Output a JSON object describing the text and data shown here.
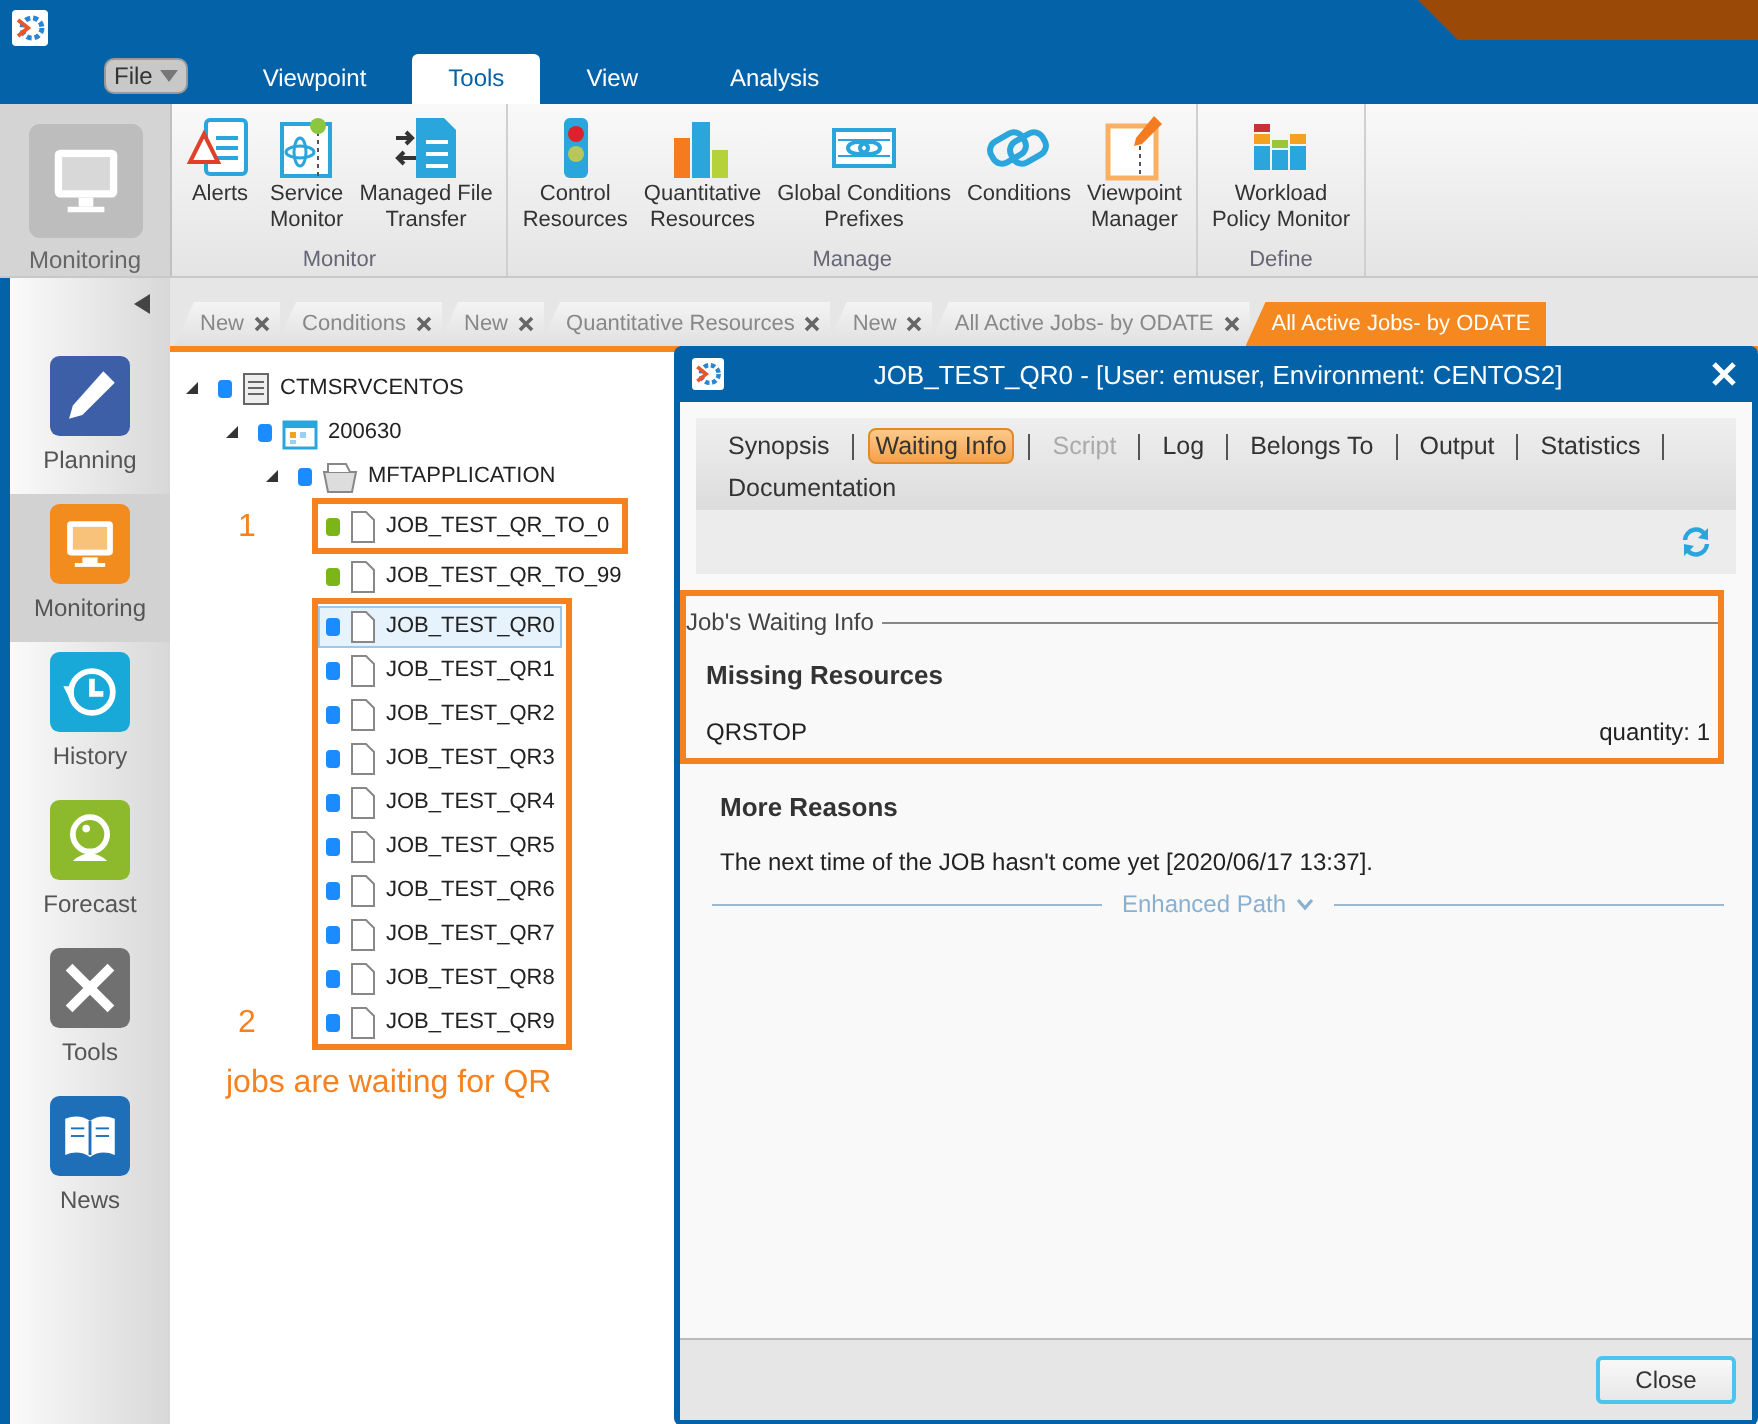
{
  "file_menu": {
    "label": "File"
  },
  "ribbon_tabs": [
    {
      "label": "Viewpoint",
      "selected": false
    },
    {
      "label": "Tools",
      "selected": true
    },
    {
      "label": "View",
      "selected": false
    },
    {
      "label": "Analysis",
      "selected": false
    }
  ],
  "ribbon": {
    "home": {
      "label": "Monitoring"
    },
    "groups": [
      {
        "name": "Monitor",
        "buttons": [
          {
            "lines": [
              "Alerts"
            ]
          },
          {
            "lines": [
              "Service",
              "Monitor"
            ]
          },
          {
            "lines": [
              "Managed File",
              "Transfer"
            ]
          }
        ]
      },
      {
        "name": "Manage",
        "buttons": [
          {
            "lines": [
              "Control",
              "Resources"
            ]
          },
          {
            "lines": [
              "Quantitative",
              "Resources"
            ]
          },
          {
            "lines": [
              "Global Conditions",
              "Prefixes"
            ]
          },
          {
            "lines": [
              "Conditions"
            ]
          },
          {
            "lines": [
              "Viewpoint",
              "Manager"
            ]
          }
        ]
      },
      {
        "name": "Define",
        "buttons": [
          {
            "lines": [
              "Workload",
              "Policy Monitor"
            ]
          }
        ]
      }
    ]
  },
  "sidebar": {
    "items": [
      {
        "label": "Planning",
        "selected": false
      },
      {
        "label": "Monitoring",
        "selected": true
      },
      {
        "label": "History",
        "selected": false
      },
      {
        "label": "Forecast",
        "selected": false
      },
      {
        "label": "Tools",
        "selected": false
      },
      {
        "label": "News",
        "selected": false
      }
    ]
  },
  "doc_tabs": [
    {
      "label": "New",
      "selected": false
    },
    {
      "label": "Conditions",
      "selected": false
    },
    {
      "label": "New",
      "selected": false
    },
    {
      "label": "Quantitative Resources",
      "selected": false
    },
    {
      "label": "New",
      "selected": false
    },
    {
      "label": "All Active Jobs- by ODATE",
      "selected": false
    },
    {
      "label": "All Active Jobs- by ODATE",
      "selected": true
    }
  ],
  "tree": {
    "nodes": [
      {
        "label": "CTMSRVCENTOS",
        "color": "#1a8cff",
        "expanded": true,
        "selected": false,
        "children": [
          {
            "label": "200630",
            "color": "#1a8cff",
            "expanded": true,
            "selected": false,
            "children": [
              {
                "label": "MFTAPPLICATION",
                "color": "#1a8cff",
                "expanded": true,
                "selected": false,
                "children": [
                  {
                    "label": "JOB_TEST_QR_TO_0",
                    "color": "#7cb518",
                    "selected": false,
                    "boxed": true
                  },
                  {
                    "label": "JOB_TEST_QR_TO_99",
                    "color": "#7cb518",
                    "selected": false,
                    "boxed": false
                  },
                  {
                    "label": "JOB_TEST_QR0",
                    "color": "#1a8cff",
                    "selected": true,
                    "boxed": true
                  },
                  {
                    "label": "JOB_TEST_QR1",
                    "color": "#1a8cff",
                    "selected": false,
                    "boxed": true
                  },
                  {
                    "label": "JOB_TEST_QR2",
                    "color": "#1a8cff",
                    "selected": false,
                    "boxed": true
                  },
                  {
                    "label": "JOB_TEST_QR3",
                    "color": "#1a8cff",
                    "selected": false,
                    "boxed": true
                  },
                  {
                    "label": "JOB_TEST_QR4",
                    "color": "#1a8cff",
                    "selected": false,
                    "boxed": true
                  },
                  {
                    "label": "JOB_TEST_QR5",
                    "color": "#1a8cff",
                    "selected": false,
                    "boxed": true
                  },
                  {
                    "label": "JOB_TEST_QR6",
                    "color": "#1a8cff",
                    "selected": false,
                    "boxed": true
                  },
                  {
                    "label": "JOB_TEST_QR7",
                    "color": "#1a8cff",
                    "selected": false,
                    "boxed": true
                  },
                  {
                    "label": "JOB_TEST_QR8",
                    "color": "#1a8cff",
                    "selected": false,
                    "boxed": true
                  },
                  {
                    "label": "JOB_TEST_QR9",
                    "color": "#1a8cff",
                    "selected": false,
                    "boxed": true
                  }
                ]
              }
            ]
          }
        ]
      }
    ]
  },
  "annotations": {
    "box_labels": [
      "1",
      "2"
    ],
    "caption": "jobs are waiting for QR"
  },
  "dialog": {
    "title": "JOB_TEST_QR0 - [User: emuser, Environment: CENTOS2]",
    "tabs": [
      {
        "label": "Synopsis",
        "selected": false,
        "disabled": false
      },
      {
        "label": "Waiting Info",
        "selected": true,
        "disabled": false
      },
      {
        "label": "Script",
        "selected": false,
        "disabled": true
      },
      {
        "label": "Log",
        "selected": false,
        "disabled": false
      },
      {
        "label": "Belongs To",
        "selected": false,
        "disabled": false
      },
      {
        "label": "Output",
        "selected": false,
        "disabled": false
      },
      {
        "label": "Statistics",
        "selected": false,
        "disabled": false
      },
      {
        "label": "Documentation",
        "selected": false,
        "disabled": false
      }
    ],
    "waiting_info": {
      "legend": "Job's Waiting Info",
      "heading": "Missing Resources",
      "highlighted": true,
      "resources": [
        {
          "name": "QRSTOP",
          "quantity": "quantity: 1"
        }
      ]
    },
    "more_reasons": {
      "heading": "More Reasons",
      "text": "The next time of the JOB hasn't come yet [2020/06/17 13:37]."
    },
    "enhanced_path": "Enhanced Path",
    "close_button": "Close"
  }
}
